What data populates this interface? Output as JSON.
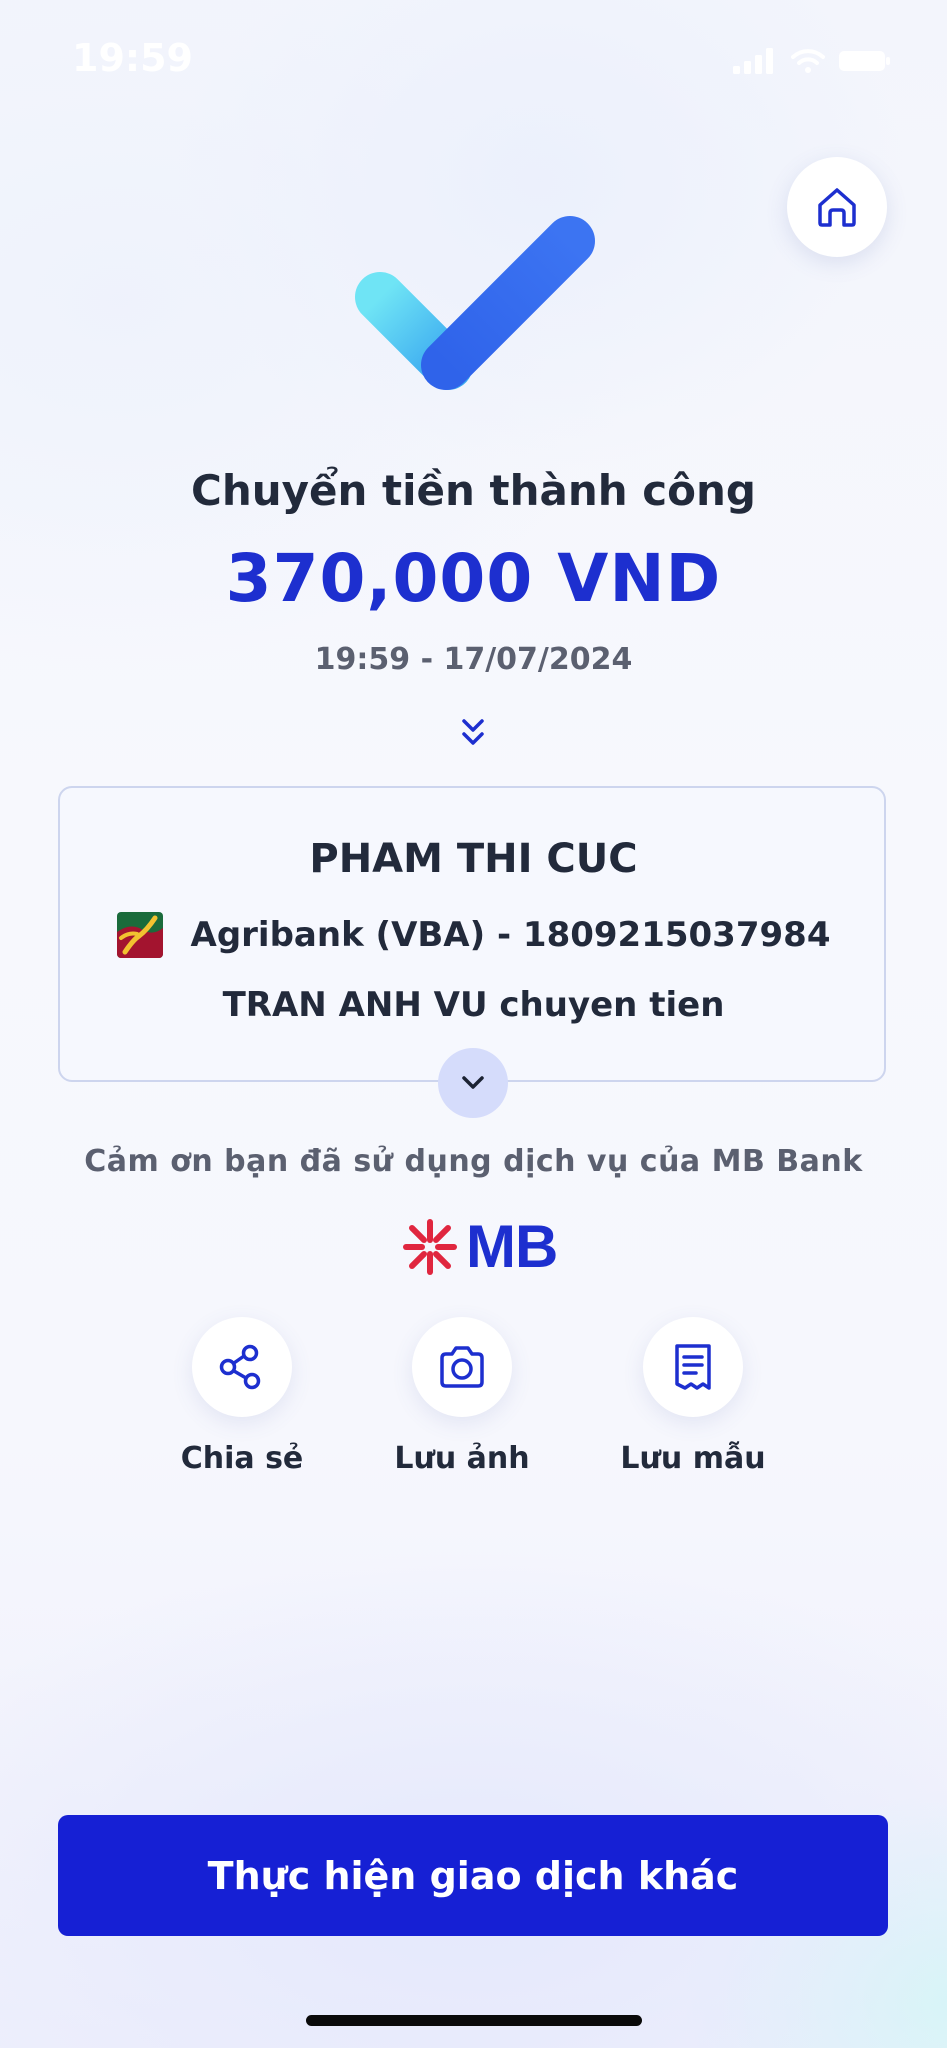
{
  "status_bar": {
    "time": "19:59"
  },
  "header": {
    "home_icon": "home-icon"
  },
  "result": {
    "title": "Chuyển tiền thành công",
    "amount": "370,000 VND",
    "datetime": "19:59 - 17/07/2024"
  },
  "recipient": {
    "name": "PHAM THI CUC",
    "bank_account": "Agribank (VBA) - 1809215037984",
    "memo": "TRAN ANH VU chuyen tien"
  },
  "footer_note": {
    "thanks": "Cảm ơn bạn đã sử dụng dịch vụ của MB Bank",
    "brand": "MB"
  },
  "actions": [
    {
      "label": "Chia sẻ",
      "icon": "share-icon"
    },
    {
      "label": "Lưu ảnh",
      "icon": "camera-icon"
    },
    {
      "label": "Lưu mẫu",
      "icon": "receipt-icon"
    }
  ],
  "cta": {
    "label": "Thực hiện giao dịch khác"
  },
  "colors": {
    "primary": "#1620d4",
    "amount": "#1d2fcf",
    "text": "#222a3b",
    "muted": "#5b6070",
    "mb_red": "#e0263f"
  }
}
